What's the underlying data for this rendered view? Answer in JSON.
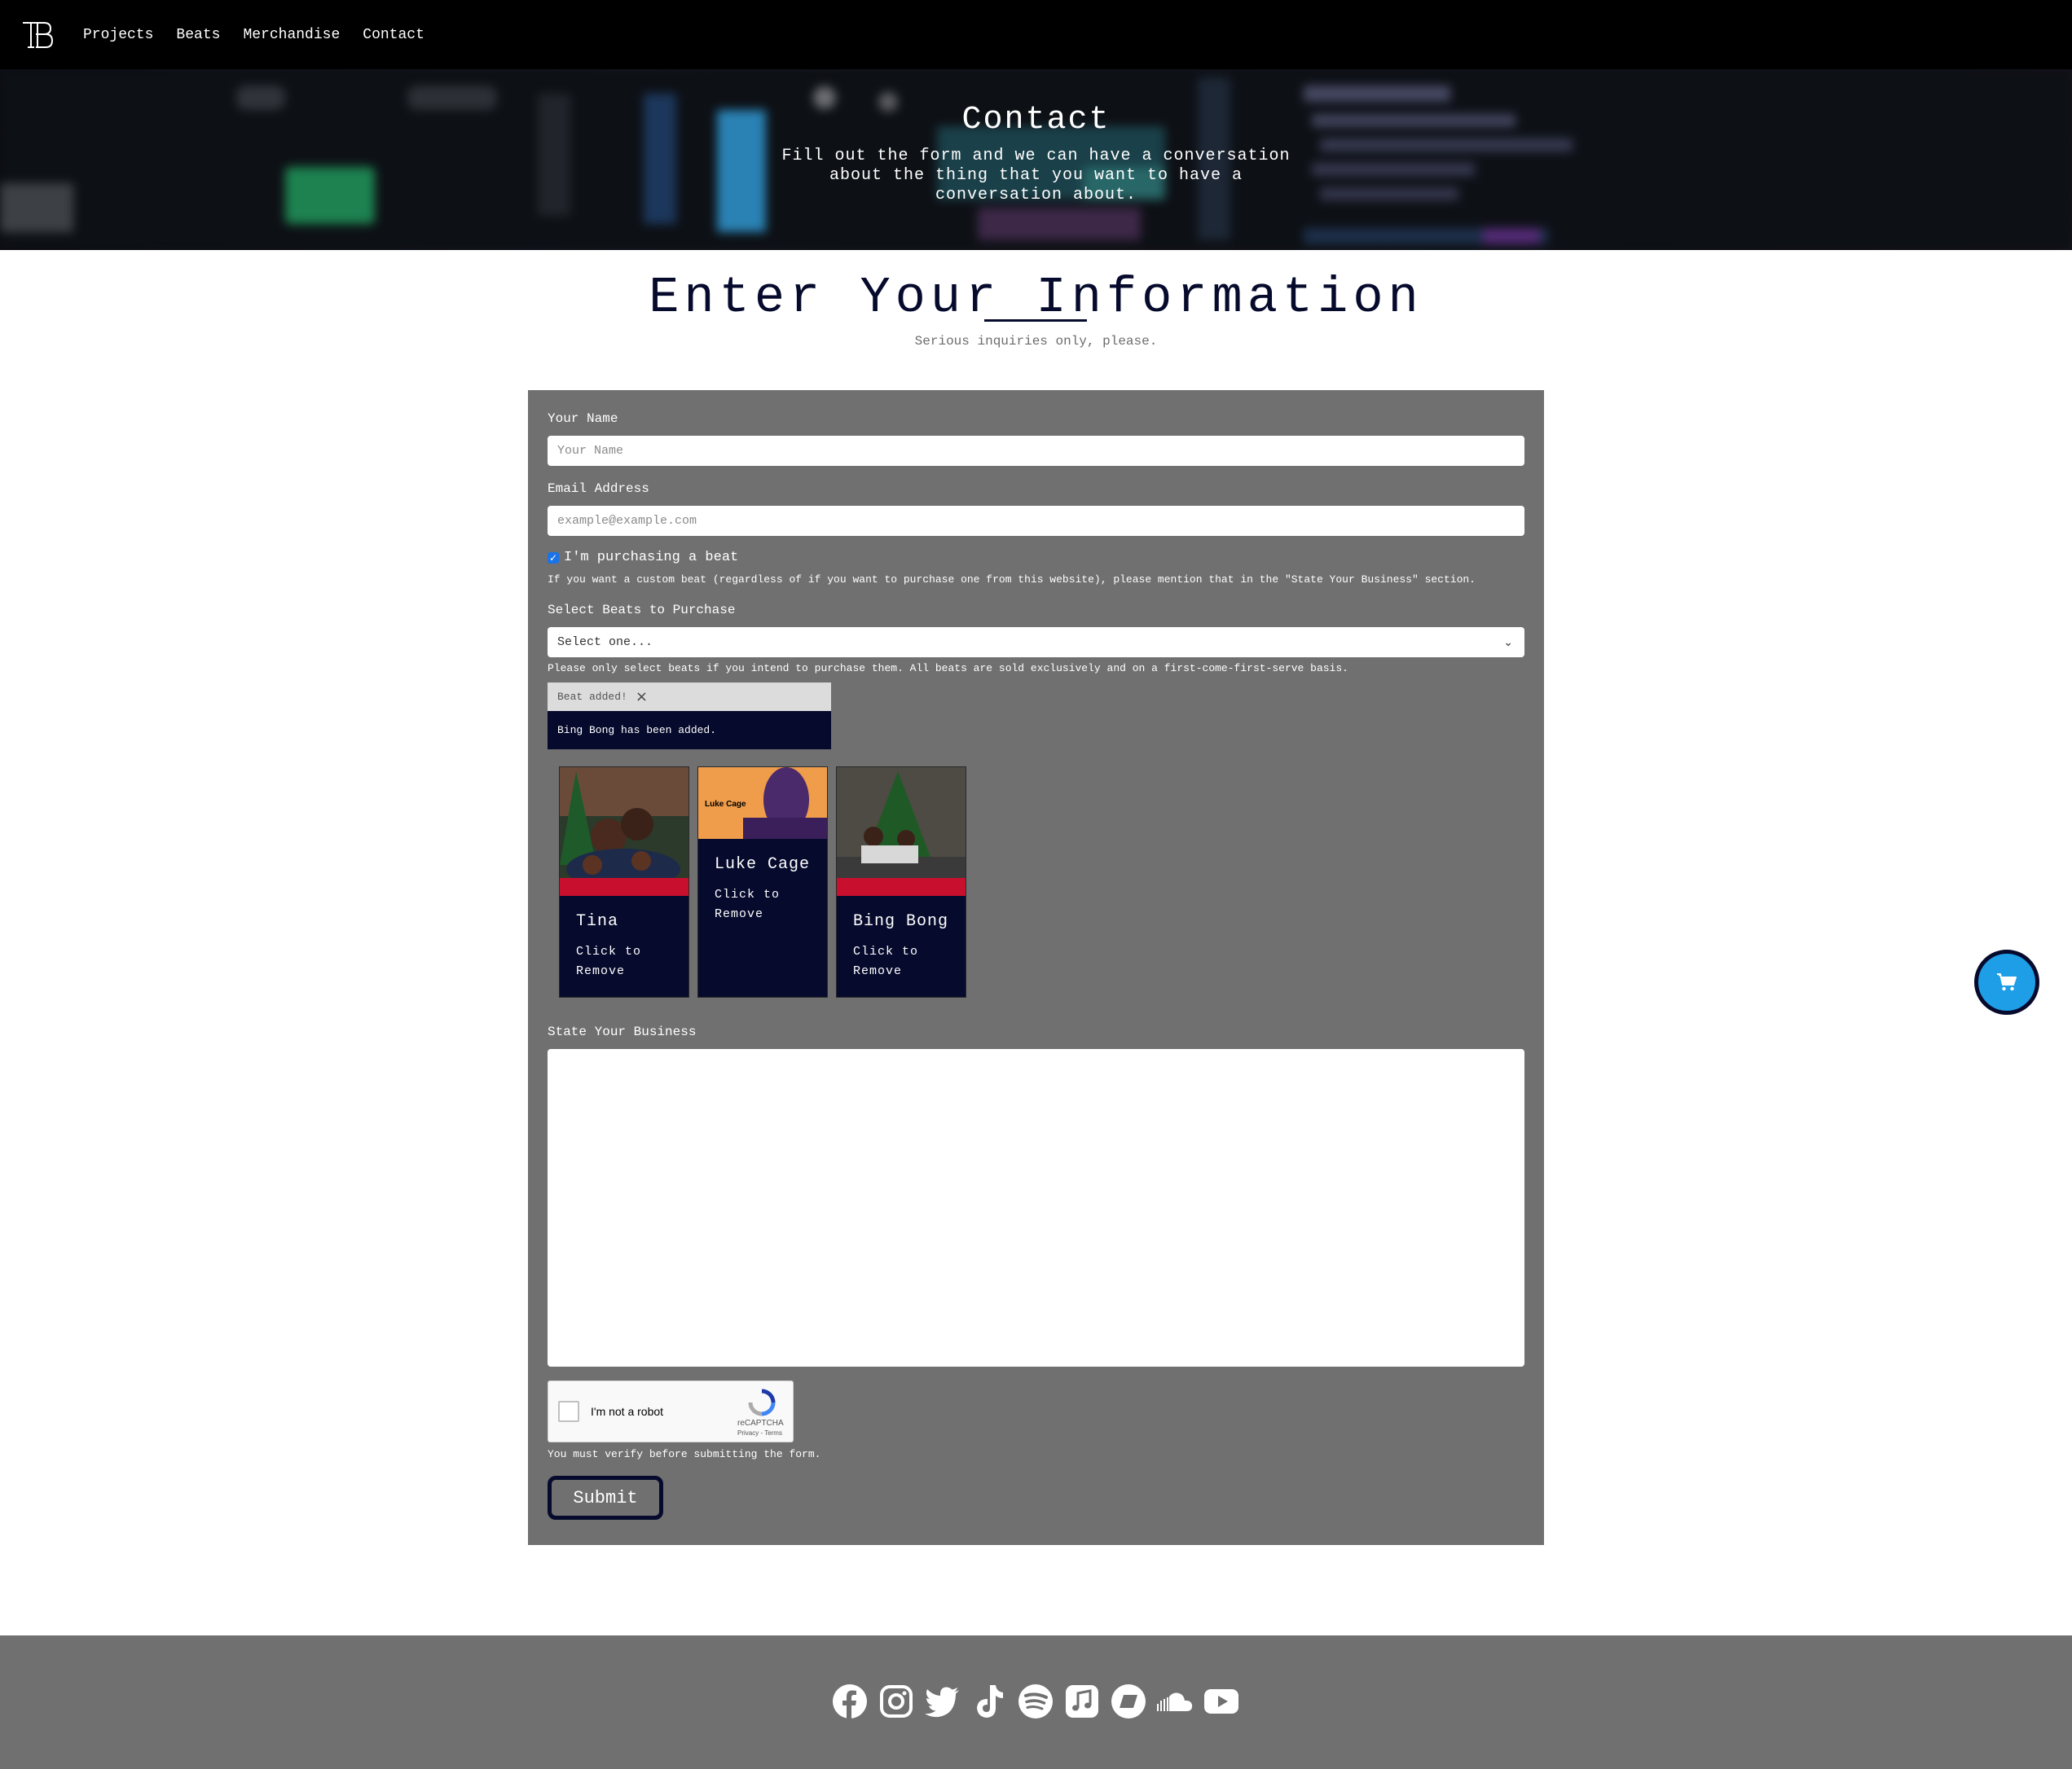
{
  "nav": {
    "logo_alt": "TB logo",
    "links": [
      "Projects",
      "Beats",
      "Merchandise",
      "Contact"
    ]
  },
  "hero": {
    "title": "Contact",
    "subtitle": "Fill out the form and we can have a conversation about the thing that you want to have a conversation about."
  },
  "main": {
    "heading": "Enter Your Information",
    "subheading": "Serious inquiries only, please."
  },
  "form": {
    "name_label": "Your Name",
    "name_placeholder": "Your Name",
    "email_label": "Email Address",
    "email_placeholder": "example@example.com",
    "purchase_checkbox": {
      "label": "I'm purchasing a beat",
      "checked": true
    },
    "purchase_help": "If you want a custom beat (regardless of if you want to purchase one from this website), please mention that in the \"State Your Business\" section.",
    "beats_label": "Select Beats to Purchase",
    "beats_select_value": "Select one...",
    "beats_help": "Please only select beats if you intend to purchase them. All beats are sold exclusively and on a first-come-first-serve basis.",
    "toast": {
      "title": "Beat added!",
      "close": "×",
      "body": "Bing Bong has been added."
    },
    "selected_beats": [
      {
        "name": "Tina",
        "action": "Click to Remove"
      },
      {
        "name": "Luke Cage",
        "action": "Click to Remove",
        "cover_text": "Luke Cage"
      },
      {
        "name": "Bing Bong",
        "action": "Click to Remove"
      }
    ],
    "business_label": "State Your Business",
    "business_value": "",
    "recaptcha": {
      "label": "I'm not a robot",
      "brand": "reCAPTCHA",
      "terms": "Privacy - Terms"
    },
    "verify_help": "You must verify before submitting the form.",
    "submit_label": "Submit"
  },
  "cart": {
    "icon": "shopping-cart-icon"
  },
  "footer": {
    "socials": [
      "facebook-icon",
      "instagram-icon",
      "twitter-icon",
      "tiktok-icon",
      "spotify-icon",
      "apple-music-icon",
      "bandcamp-icon",
      "soundcloud-icon",
      "youtube-icon"
    ]
  },
  "colors": {
    "navy": "#060a2c",
    "panel_gray": "#707070",
    "cart_blue": "#1e9ee6",
    "cover_red": "#c8102e",
    "cover_orange": "#ef9c4b"
  }
}
